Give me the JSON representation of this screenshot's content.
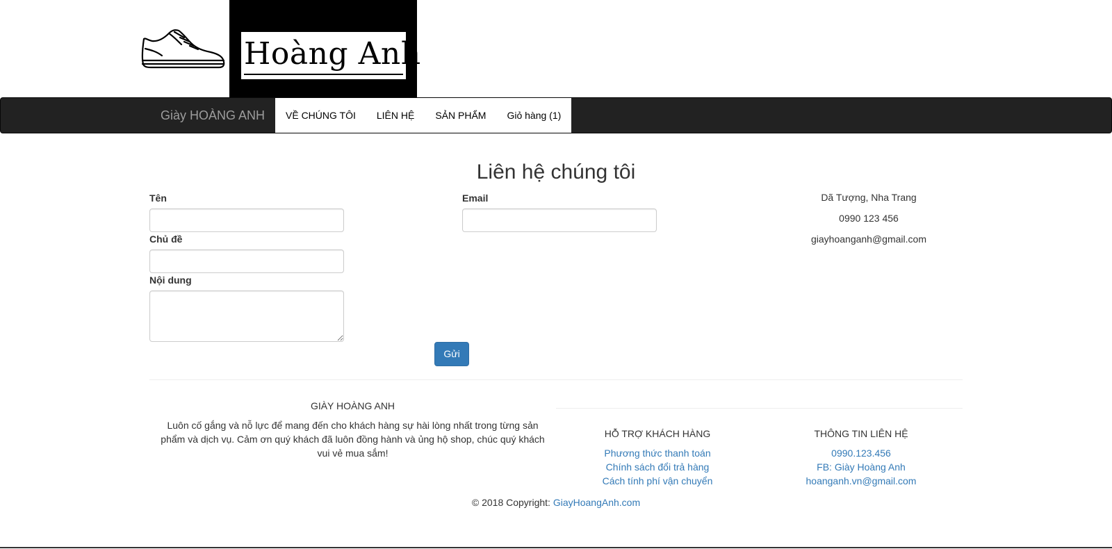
{
  "header": {
    "logo_icon": "sneaker-icon",
    "brand_name": "Hoàng Anh"
  },
  "navbar": {
    "brand": "Giày HOÀNG ANH",
    "items": [
      {
        "label": "VỀ CHÚNG TÔI"
      },
      {
        "label": "LIÊN HỆ"
      },
      {
        "label": "SẢN PHẨM"
      },
      {
        "label": "Giỏ hàng (1)"
      }
    ]
  },
  "contact_form": {
    "title": "Liên hệ chúng tôi",
    "name_label": "Tên",
    "name_value": "",
    "email_label": "Email",
    "email_value": "",
    "subject_label": "Chủ đề",
    "subject_value": "",
    "message_label": "Nội dung",
    "message_value": "",
    "submit_label": "Gửi"
  },
  "contact_info": {
    "address": "Dã Tượng, Nha Trang",
    "phone": "0990 123 456",
    "email": "giayhoanganh@gmail.com"
  },
  "footer": {
    "about_title": "GIÀY HOÀNG ANH",
    "about_text": "Luôn cố gắng và nỗ lực để mang đến cho khách hàng sự hài lòng nhất trong từng sản phẩm và dịch vụ. Cảm ơn quý khách đã luôn đồng hành và ủng hộ shop, chúc quý khách vui vẻ mua sắm!",
    "support": {
      "title": "HỖ TRỢ KHÁCH HÀNG",
      "links": [
        "Phương thức thanh toán",
        "Chính sách đổi trả hàng",
        "Cách tính phí vận chuyển"
      ]
    },
    "contact": {
      "title": "THÔNG TIN LIÊN HỆ",
      "links": [
        "0990.123.456",
        "FB: Giày Hoàng Anh",
        "hoanganh.vn@gmail.com"
      ]
    },
    "copyright_text": "© 2018 Copyright:",
    "copyright_link": "GiayHoangAnh.com"
  },
  "colors": {
    "navbar_bg": "#222222",
    "link": "#337ab7",
    "button": "#337ab7",
    "brand_box": "#000000"
  }
}
